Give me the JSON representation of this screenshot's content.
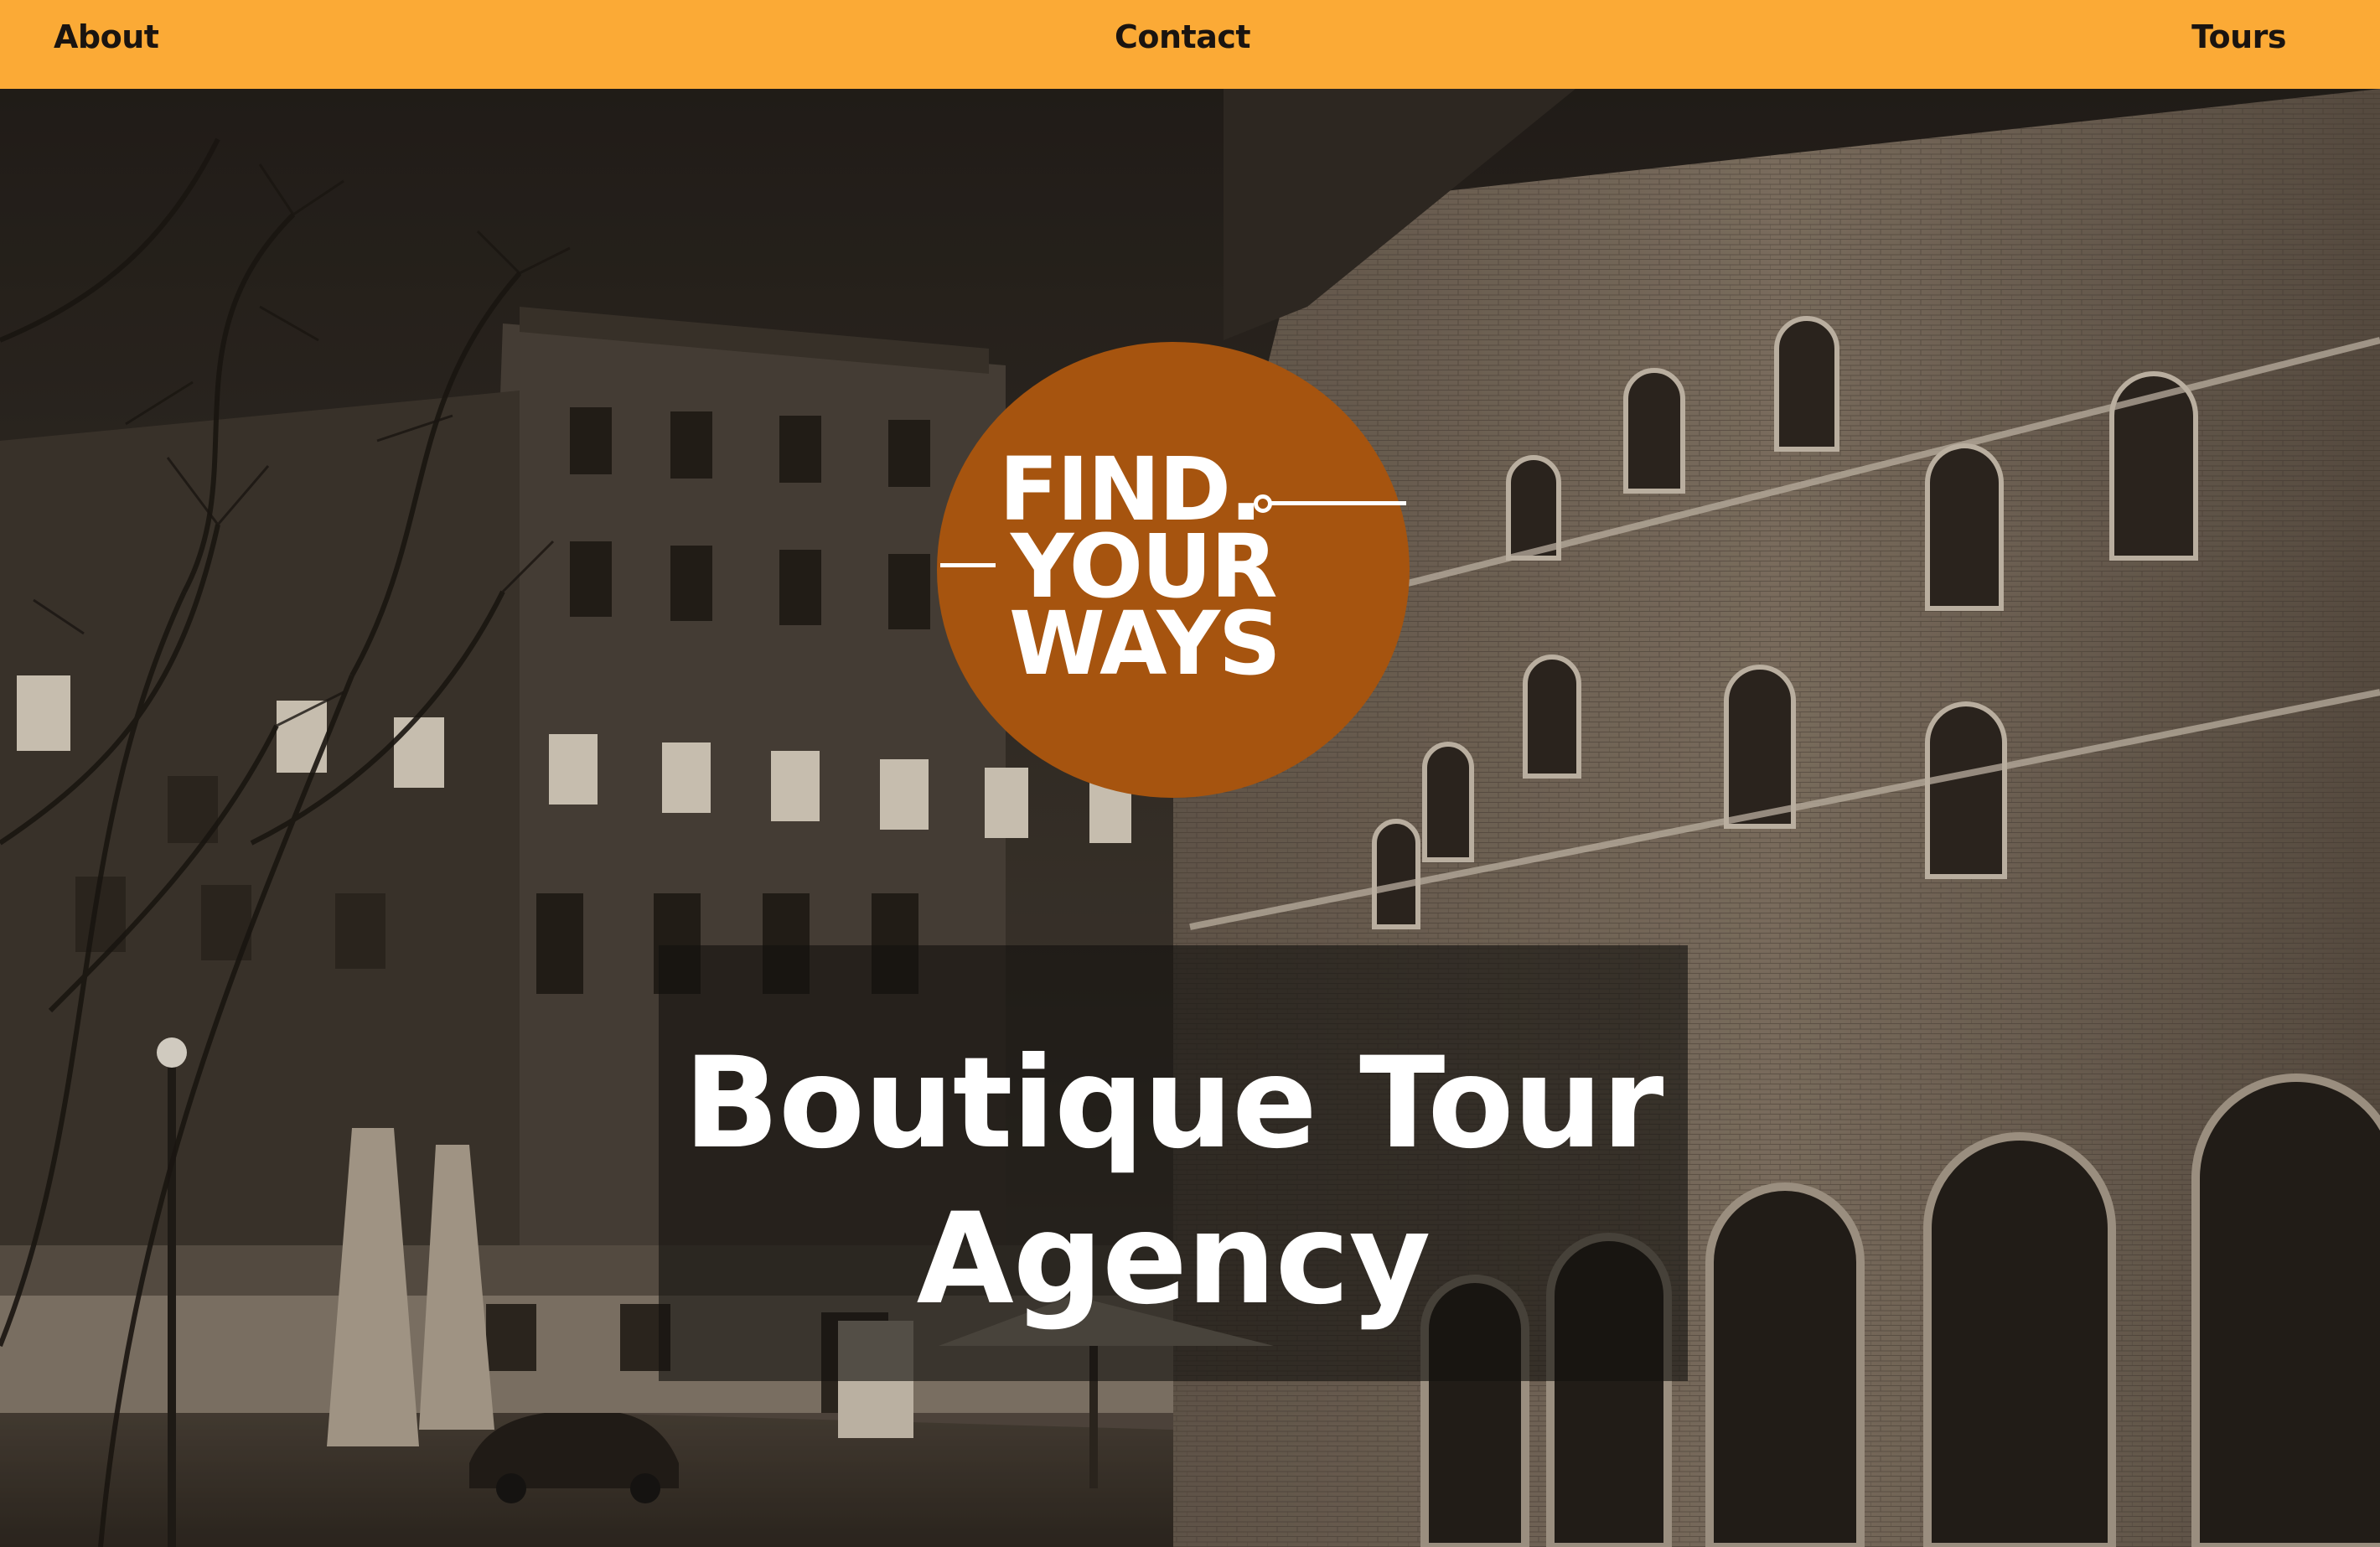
{
  "nav": {
    "about": "About",
    "contact": "Contact",
    "tours": "Tours",
    "background_color": "#fbaa36"
  },
  "logo": {
    "line1": "FIND.",
    "line2": "YOUR",
    "line3": "WAYS",
    "color": "#a6540f"
  },
  "hero": {
    "headline": "Boutique Tour Agency",
    "image_description_icon": "city-street-night-photo"
  }
}
